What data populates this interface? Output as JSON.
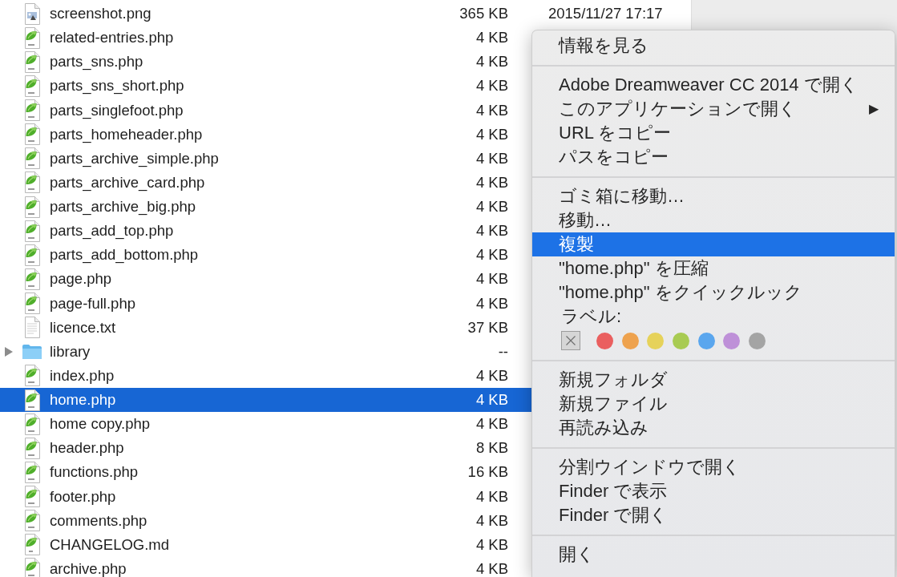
{
  "file_list": {
    "rows": [
      {
        "kind": "image",
        "name": "screenshot.png",
        "size": "365 KB",
        "date": "2015/11/27 17:17",
        "selected": false
      },
      {
        "kind": "php",
        "name": "related-entries.php",
        "size": "4 KB",
        "selected": false
      },
      {
        "kind": "php",
        "name": "parts_sns.php",
        "size": "4 KB",
        "selected": false
      },
      {
        "kind": "php",
        "name": "parts_sns_short.php",
        "size": "4 KB",
        "selected": false
      },
      {
        "kind": "php",
        "name": "parts_singlefoot.php",
        "size": "4 KB",
        "selected": false
      },
      {
        "kind": "php",
        "name": "parts_homeheader.php",
        "size": "4 KB",
        "selected": false
      },
      {
        "kind": "php",
        "name": "parts_archive_simple.php",
        "size": "4 KB",
        "selected": false
      },
      {
        "kind": "php",
        "name": "parts_archive_card.php",
        "size": "4 KB",
        "selected": false
      },
      {
        "kind": "php",
        "name": "parts_archive_big.php",
        "size": "4 KB",
        "selected": false
      },
      {
        "kind": "php",
        "name": "parts_add_top.php",
        "size": "4 KB",
        "selected": false
      },
      {
        "kind": "php",
        "name": "parts_add_bottom.php",
        "size": "4 KB",
        "selected": false
      },
      {
        "kind": "php",
        "name": "page.php",
        "size": "4 KB",
        "selected": false
      },
      {
        "kind": "php",
        "name": "page-full.php",
        "size": "4 KB",
        "selected": false
      },
      {
        "kind": "text",
        "name": "licence.txt",
        "size": "37 KB",
        "selected": false
      },
      {
        "kind": "folder",
        "name": "library",
        "size": "--",
        "selected": false,
        "expanded": false
      },
      {
        "kind": "php",
        "name": "index.php",
        "size": "4 KB",
        "selected": false
      },
      {
        "kind": "php",
        "name": "home.php",
        "size": "4 KB",
        "selected": true
      },
      {
        "kind": "php",
        "name": "home copy.php",
        "size": "4 KB",
        "selected": false
      },
      {
        "kind": "php",
        "name": "header.php",
        "size": "8 KB",
        "selected": false
      },
      {
        "kind": "php",
        "name": "functions.php",
        "size": "16 KB",
        "selected": false
      },
      {
        "kind": "php",
        "name": "footer.php",
        "size": "4 KB",
        "selected": false
      },
      {
        "kind": "php",
        "name": "comments.php",
        "size": "4 KB",
        "selected": false
      },
      {
        "kind": "md",
        "name": "CHANGELOG.md",
        "size": "4 KB",
        "selected": false
      },
      {
        "kind": "php",
        "name": "archive.php",
        "size": "4 KB",
        "selected": false
      }
    ]
  },
  "context_menu": {
    "sections": [
      {
        "items": [
          {
            "label": "情報を見る",
            "selected": false
          }
        ]
      },
      {
        "items": [
          {
            "label": "Adobe Dreamweaver CC 2014 で開く",
            "selected": false
          },
          {
            "label": "このアプリケーションで開く",
            "selected": false,
            "arrow": "▶"
          },
          {
            "label": "URL をコピー",
            "selected": false
          },
          {
            "label": "パスをコピー",
            "selected": false
          }
        ]
      },
      {
        "items": [
          {
            "label": "ゴミ箱に移動…",
            "selected": false
          },
          {
            "label": "移動…",
            "selected": false
          },
          {
            "label": "複製",
            "selected": true
          },
          {
            "label": "\"home.php\" を圧縮",
            "selected": false
          },
          {
            "label": "\"home.php\" をクイックルック",
            "selected": false
          }
        ],
        "label_picker": {
          "title": "ラベル:",
          "colors": [
            {
              "color": "#ea5f5f"
            },
            {
              "color": "#eea24e"
            },
            {
              "color": "#e6d25a"
            },
            {
              "color": "#a8cb52"
            },
            {
              "color": "#5aa6ee"
            },
            {
              "color": "#be90d8"
            },
            {
              "color": "#a4a4a4"
            }
          ]
        }
      },
      {
        "items": [
          {
            "label": "新規フォルダ",
            "selected": false
          },
          {
            "label": "新規ファイル",
            "selected": false
          },
          {
            "label": "再読み込み",
            "selected": false
          }
        ]
      },
      {
        "items": [
          {
            "label": "分割ウインドウで開く",
            "selected": false
          },
          {
            "label": "Finder で表示",
            "selected": false
          },
          {
            "label": "Finder で開く",
            "selected": false
          }
        ]
      },
      {
        "items": [
          {
            "label": "開く",
            "selected": false
          }
        ]
      }
    ]
  }
}
